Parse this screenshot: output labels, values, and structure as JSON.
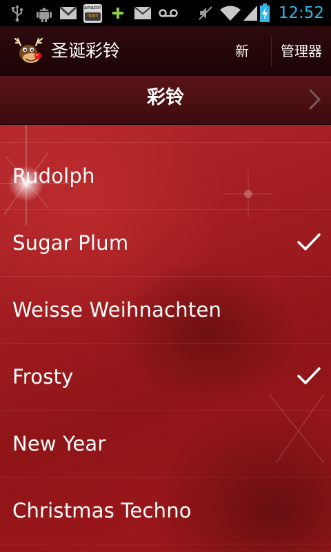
{
  "status_bar": {
    "time": "12:52",
    "icons": [
      "usb-icon",
      "android-debug-icon",
      "gmail-icon",
      "amazon-appstore-icon",
      "add-icon",
      "email-icon",
      "voicemail-icon",
      "mute-icon",
      "wifi-icon",
      "signal-icon",
      "battery-charging-icon"
    ],
    "amazon_label": "amazon",
    "amazon_sublabel": "apps"
  },
  "action_bar": {
    "title": "圣诞彩铃",
    "new_label": "新",
    "manage_label": "管理器"
  },
  "header": {
    "title": "彩铃"
  },
  "ringtones": [
    {
      "label": "Rudolph",
      "selected": false
    },
    {
      "label": "Sugar Plum",
      "selected": true
    },
    {
      "label": "Weisse Weihnachten",
      "selected": false
    },
    {
      "label": "Frosty",
      "selected": true
    },
    {
      "label": "New Year",
      "selected": false
    },
    {
      "label": "Christmas Techno",
      "selected": false
    }
  ],
  "colors": {
    "accent_clock": "#34b5e5",
    "background_red": "#a11c20",
    "action_bar": "#2e0a0d"
  }
}
